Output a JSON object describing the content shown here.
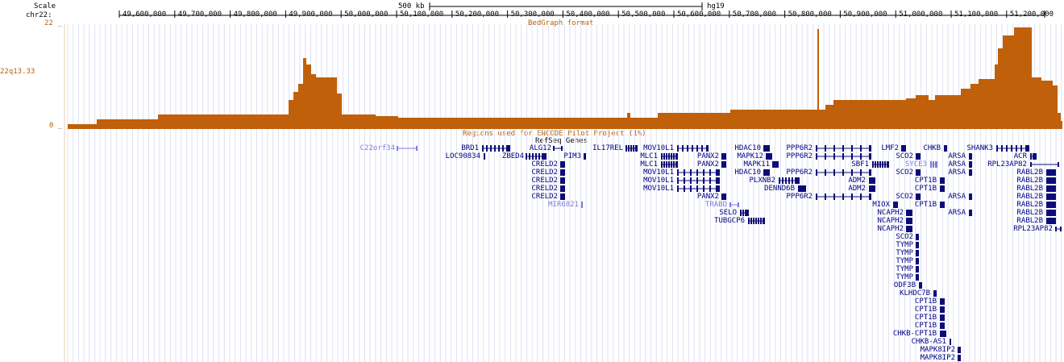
{
  "scale": {
    "label": "Scale",
    "bar_label": "500 kb",
    "assembly": "hg19"
  },
  "ruler": {
    "chrom_label": "chr22:",
    "ticks": [
      "49,600,000",
      "49,700,000",
      "49,800,000",
      "49,900,000",
      "50,000,000",
      "50,100,000",
      "50,200,000",
      "50,300,000",
      "50,400,000",
      "50,500,000",
      "50,600,000",
      "50,700,000",
      "50,800,000",
      "50,900,000",
      "51,000,000",
      "51,100,000",
      "51,200,000"
    ]
  },
  "bedgraph_track": {
    "title": "BedGraph format",
    "max_label": "22 _",
    "min_label": "0 _",
    "side_label": "22q13.33",
    "color": "#c0600a"
  },
  "encode_track": {
    "title": "Regions used for ENCODE Pilot Project (1%)"
  },
  "refseq_track": {
    "title": "RefSeq Genes",
    "color": "#0c0c78",
    "labels": [
      "C22orf34",
      "BRD1",
      "LOC90834",
      "ZBED4",
      "ALG12",
      "PIM3",
      "CRELD2",
      "CRELD2",
      "CRELD2",
      "CRELD2",
      "CRELD2",
      "MIR6821",
      "IL17REL",
      "MLC1",
      "MLC1",
      "MOV10L1",
      "MOV10L1",
      "MOV10L1",
      "MOV10L1",
      "PANX2",
      "PANX2",
      "PANX2",
      "TRABD",
      "SELO",
      "TUBGCP6",
      "HDAC10",
      "MAPK12",
      "MAPK11",
      "HDAC10",
      "PLXNB2",
      "DENND6B",
      "PPP6R2",
      "PPP6R2",
      "PPP6R2",
      "PPP6R2",
      "SBF1",
      "ADM2",
      "ADM2",
      "MIOX",
      "NCAPH2",
      "NCAPH2",
      "NCAPH2",
      "LMF2",
      "SCO2",
      "SCO2",
      "SCO2",
      "SCO2",
      "TYMP",
      "TYMP",
      "TYMP",
      "TYMP",
      "TYMP",
      "ODF3B",
      "KLHDC7B",
      "SYCE3",
      "CHKB",
      "CPT1B",
      "CPT1B",
      "CPT1B",
      "CPT1B",
      "CPT1B",
      "CPT1B",
      "CPT1B",
      "CHKB-CPT1B",
      "CHKB-AS1",
      "MAPK8IP2",
      "MAPK8IP2",
      "SHANK3",
      "ARSA",
      "ARSA",
      "ARSA",
      "ARSA",
      "ARSA",
      "ACR",
      "RPL23AP82",
      "RPL23AP82",
      "RABL2B",
      "RABL2B",
      "RABL2B",
      "RABL2B",
      "RABL2B",
      "RABL2B",
      "RABL2B"
    ]
  }
}
